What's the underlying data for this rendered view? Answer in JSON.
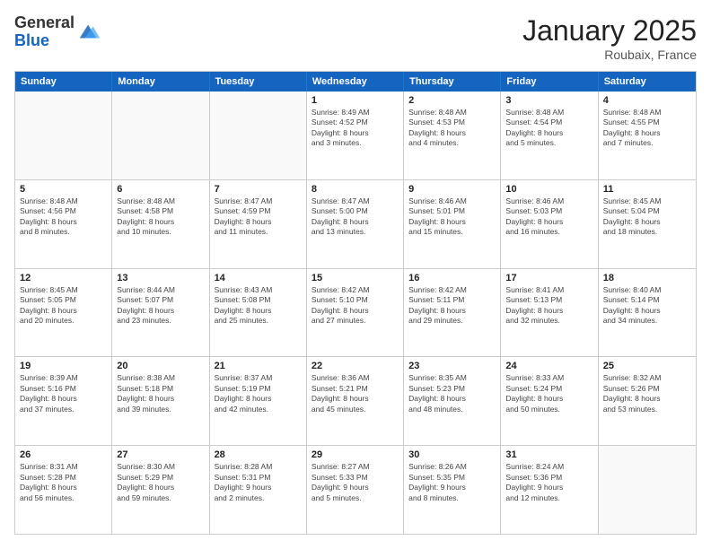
{
  "header": {
    "logo_general": "General",
    "logo_blue": "Blue",
    "month_title": "January 2025",
    "location": "Roubaix, France"
  },
  "weekdays": [
    "Sunday",
    "Monday",
    "Tuesday",
    "Wednesday",
    "Thursday",
    "Friday",
    "Saturday"
  ],
  "rows": [
    [
      {
        "day": "",
        "text": ""
      },
      {
        "day": "",
        "text": ""
      },
      {
        "day": "",
        "text": ""
      },
      {
        "day": "1",
        "text": "Sunrise: 8:49 AM\nSunset: 4:52 PM\nDaylight: 8 hours\nand 3 minutes."
      },
      {
        "day": "2",
        "text": "Sunrise: 8:48 AM\nSunset: 4:53 PM\nDaylight: 8 hours\nand 4 minutes."
      },
      {
        "day": "3",
        "text": "Sunrise: 8:48 AM\nSunset: 4:54 PM\nDaylight: 8 hours\nand 5 minutes."
      },
      {
        "day": "4",
        "text": "Sunrise: 8:48 AM\nSunset: 4:55 PM\nDaylight: 8 hours\nand 7 minutes."
      }
    ],
    [
      {
        "day": "5",
        "text": "Sunrise: 8:48 AM\nSunset: 4:56 PM\nDaylight: 8 hours\nand 8 minutes."
      },
      {
        "day": "6",
        "text": "Sunrise: 8:48 AM\nSunset: 4:58 PM\nDaylight: 8 hours\nand 10 minutes."
      },
      {
        "day": "7",
        "text": "Sunrise: 8:47 AM\nSunset: 4:59 PM\nDaylight: 8 hours\nand 11 minutes."
      },
      {
        "day": "8",
        "text": "Sunrise: 8:47 AM\nSunset: 5:00 PM\nDaylight: 8 hours\nand 13 minutes."
      },
      {
        "day": "9",
        "text": "Sunrise: 8:46 AM\nSunset: 5:01 PM\nDaylight: 8 hours\nand 15 minutes."
      },
      {
        "day": "10",
        "text": "Sunrise: 8:46 AM\nSunset: 5:03 PM\nDaylight: 8 hours\nand 16 minutes."
      },
      {
        "day": "11",
        "text": "Sunrise: 8:45 AM\nSunset: 5:04 PM\nDaylight: 8 hours\nand 18 minutes."
      }
    ],
    [
      {
        "day": "12",
        "text": "Sunrise: 8:45 AM\nSunset: 5:05 PM\nDaylight: 8 hours\nand 20 minutes."
      },
      {
        "day": "13",
        "text": "Sunrise: 8:44 AM\nSunset: 5:07 PM\nDaylight: 8 hours\nand 23 minutes."
      },
      {
        "day": "14",
        "text": "Sunrise: 8:43 AM\nSunset: 5:08 PM\nDaylight: 8 hours\nand 25 minutes."
      },
      {
        "day": "15",
        "text": "Sunrise: 8:42 AM\nSunset: 5:10 PM\nDaylight: 8 hours\nand 27 minutes."
      },
      {
        "day": "16",
        "text": "Sunrise: 8:42 AM\nSunset: 5:11 PM\nDaylight: 8 hours\nand 29 minutes."
      },
      {
        "day": "17",
        "text": "Sunrise: 8:41 AM\nSunset: 5:13 PM\nDaylight: 8 hours\nand 32 minutes."
      },
      {
        "day": "18",
        "text": "Sunrise: 8:40 AM\nSunset: 5:14 PM\nDaylight: 8 hours\nand 34 minutes."
      }
    ],
    [
      {
        "day": "19",
        "text": "Sunrise: 8:39 AM\nSunset: 5:16 PM\nDaylight: 8 hours\nand 37 minutes."
      },
      {
        "day": "20",
        "text": "Sunrise: 8:38 AM\nSunset: 5:18 PM\nDaylight: 8 hours\nand 39 minutes."
      },
      {
        "day": "21",
        "text": "Sunrise: 8:37 AM\nSunset: 5:19 PM\nDaylight: 8 hours\nand 42 minutes."
      },
      {
        "day": "22",
        "text": "Sunrise: 8:36 AM\nSunset: 5:21 PM\nDaylight: 8 hours\nand 45 minutes."
      },
      {
        "day": "23",
        "text": "Sunrise: 8:35 AM\nSunset: 5:23 PM\nDaylight: 8 hours\nand 48 minutes."
      },
      {
        "day": "24",
        "text": "Sunrise: 8:33 AM\nSunset: 5:24 PM\nDaylight: 8 hours\nand 50 minutes."
      },
      {
        "day": "25",
        "text": "Sunrise: 8:32 AM\nSunset: 5:26 PM\nDaylight: 8 hours\nand 53 minutes."
      }
    ],
    [
      {
        "day": "26",
        "text": "Sunrise: 8:31 AM\nSunset: 5:28 PM\nDaylight: 8 hours\nand 56 minutes."
      },
      {
        "day": "27",
        "text": "Sunrise: 8:30 AM\nSunset: 5:29 PM\nDaylight: 8 hours\nand 59 minutes."
      },
      {
        "day": "28",
        "text": "Sunrise: 8:28 AM\nSunset: 5:31 PM\nDaylight: 9 hours\nand 2 minutes."
      },
      {
        "day": "29",
        "text": "Sunrise: 8:27 AM\nSunset: 5:33 PM\nDaylight: 9 hours\nand 5 minutes."
      },
      {
        "day": "30",
        "text": "Sunrise: 8:26 AM\nSunset: 5:35 PM\nDaylight: 9 hours\nand 8 minutes."
      },
      {
        "day": "31",
        "text": "Sunrise: 8:24 AM\nSunset: 5:36 PM\nDaylight: 9 hours\nand 12 minutes."
      },
      {
        "day": "",
        "text": ""
      }
    ]
  ]
}
